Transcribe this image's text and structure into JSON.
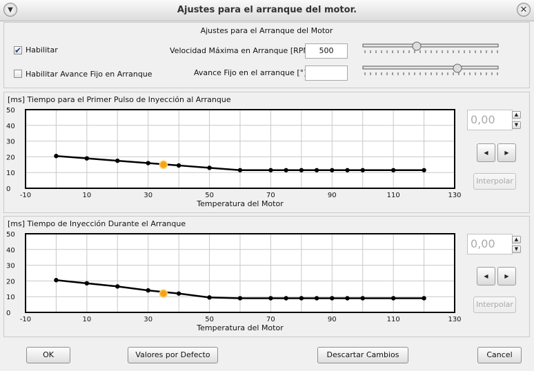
{
  "window": {
    "title": "Ajustes para el arranque del motor."
  },
  "settings": {
    "heading": "Ajustes para el Arranque del Motor",
    "enable": {
      "label": "Habilitar",
      "checked": true
    },
    "fixed_advance": {
      "label": "Habilitar Avance Fijo en Arranque",
      "checked": false
    },
    "max_speed": {
      "label": "Velocidad Máxima en Arranque [RPM]",
      "value": "500"
    },
    "advance": {
      "label": "Avance Fijo en el arranque [°]",
      "value": ""
    }
  },
  "chart_data": [
    {
      "type": "line",
      "title": "[ms] Tiempo para el Primer Pulso de Inyección al Arranque",
      "xlabel": "Temperatura del Motor",
      "ylabel": "",
      "xlim": [
        -10,
        130
      ],
      "ylim": [
        0,
        50
      ],
      "xticks": [
        "-10",
        "10",
        "30",
        "50",
        "70",
        "90",
        "110",
        "130"
      ],
      "yticks": [
        "0",
        "10",
        "20",
        "30",
        "40",
        "50"
      ],
      "grid": true,
      "x": [
        0,
        10,
        20,
        30,
        40,
        50,
        60,
        70,
        75,
        80,
        85,
        90,
        95,
        100,
        110,
        120
      ],
      "y": [
        20.5,
        19,
        17.5,
        16,
        14.5,
        13,
        11.5,
        11.5,
        11.5,
        11.5,
        11.5,
        11.5,
        11.5,
        11.5,
        11.5,
        11.5
      ],
      "cursor": {
        "x": 35,
        "y": 15
      }
    },
    {
      "type": "line",
      "title": "[ms] Tiempo de Inyección Durante el Arranque",
      "xlabel": "Temperatura del Motor",
      "ylabel": "",
      "xlim": [
        -10,
        130
      ],
      "ylim": [
        0,
        50
      ],
      "xticks": [
        "-10",
        "10",
        "30",
        "50",
        "70",
        "90",
        "110",
        "130"
      ],
      "yticks": [
        "0",
        "10",
        "20",
        "30",
        "40",
        "50"
      ],
      "grid": true,
      "x": [
        0,
        10,
        20,
        30,
        40,
        50,
        60,
        70,
        75,
        80,
        85,
        90,
        95,
        100,
        110,
        120
      ],
      "y": [
        20.5,
        18.5,
        16.5,
        14,
        12,
        9.5,
        9,
        9,
        9,
        9,
        9,
        9,
        9,
        9,
        9,
        9
      ],
      "cursor": {
        "x": 35,
        "y": 12
      }
    }
  ],
  "side": [
    {
      "value": "0,00",
      "interp": "Interpolar"
    },
    {
      "value": "0,00",
      "interp": "Interpolar"
    }
  ],
  "footer": {
    "ok": "OK",
    "defaults": "Valores por Defecto",
    "discard": "Descartar Cambios",
    "cancel": "Cancel"
  },
  "colors": {
    "line": "#000000",
    "cursor": "#f5a31a",
    "grid": "#c8c8c8"
  }
}
